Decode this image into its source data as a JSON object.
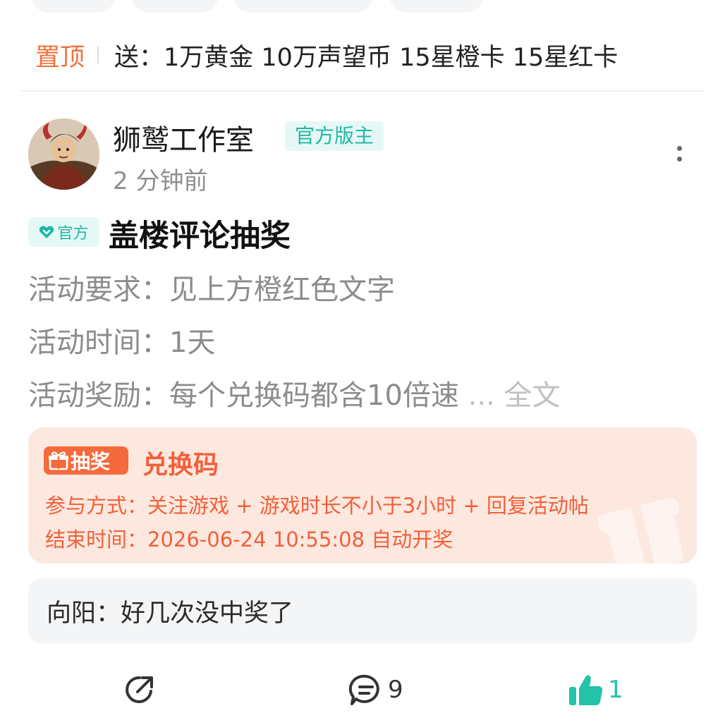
{
  "pinned": {
    "label": "置顶",
    "text": "送：1万黄金 10万声望币 15星橙卡 15星红卡"
  },
  "post": {
    "author": {
      "name": "狮鹫工作室",
      "role_badge": "官方版主",
      "time": "2 分钟前"
    },
    "official_badge": "官方",
    "title": "盖楼评论抽奖",
    "body_lines": [
      "活动要求：见上方橙红色文字",
      "活动时间：1天",
      "活动奖励：每个兑换码都含10倍速"
    ],
    "more_link": "... 全文",
    "lottery": {
      "tag": "抽奖",
      "title": "兑换码",
      "participation": "参与方式：关注游戏 + 游戏时长不小于3小时 + 回复活动帖",
      "end_time": "结束时间：2026-06-24 10:55:08 自动开奖"
    },
    "hot_comment": "向阳：好几次没中奖了",
    "actions": {
      "comments_count": "9",
      "likes_count": "1"
    }
  },
  "colors": {
    "accent_teal": "#1fb8a4",
    "pin_orange": "#f2703a",
    "lottery_red": "#f2603a",
    "lottery_bg": "#fde8df",
    "like_green": "#22c3a8"
  },
  "icons": [
    "more-vertical-icon",
    "heart-icon",
    "gift-icon",
    "share-icon",
    "comment-icon",
    "thumbs-up-icon"
  ]
}
